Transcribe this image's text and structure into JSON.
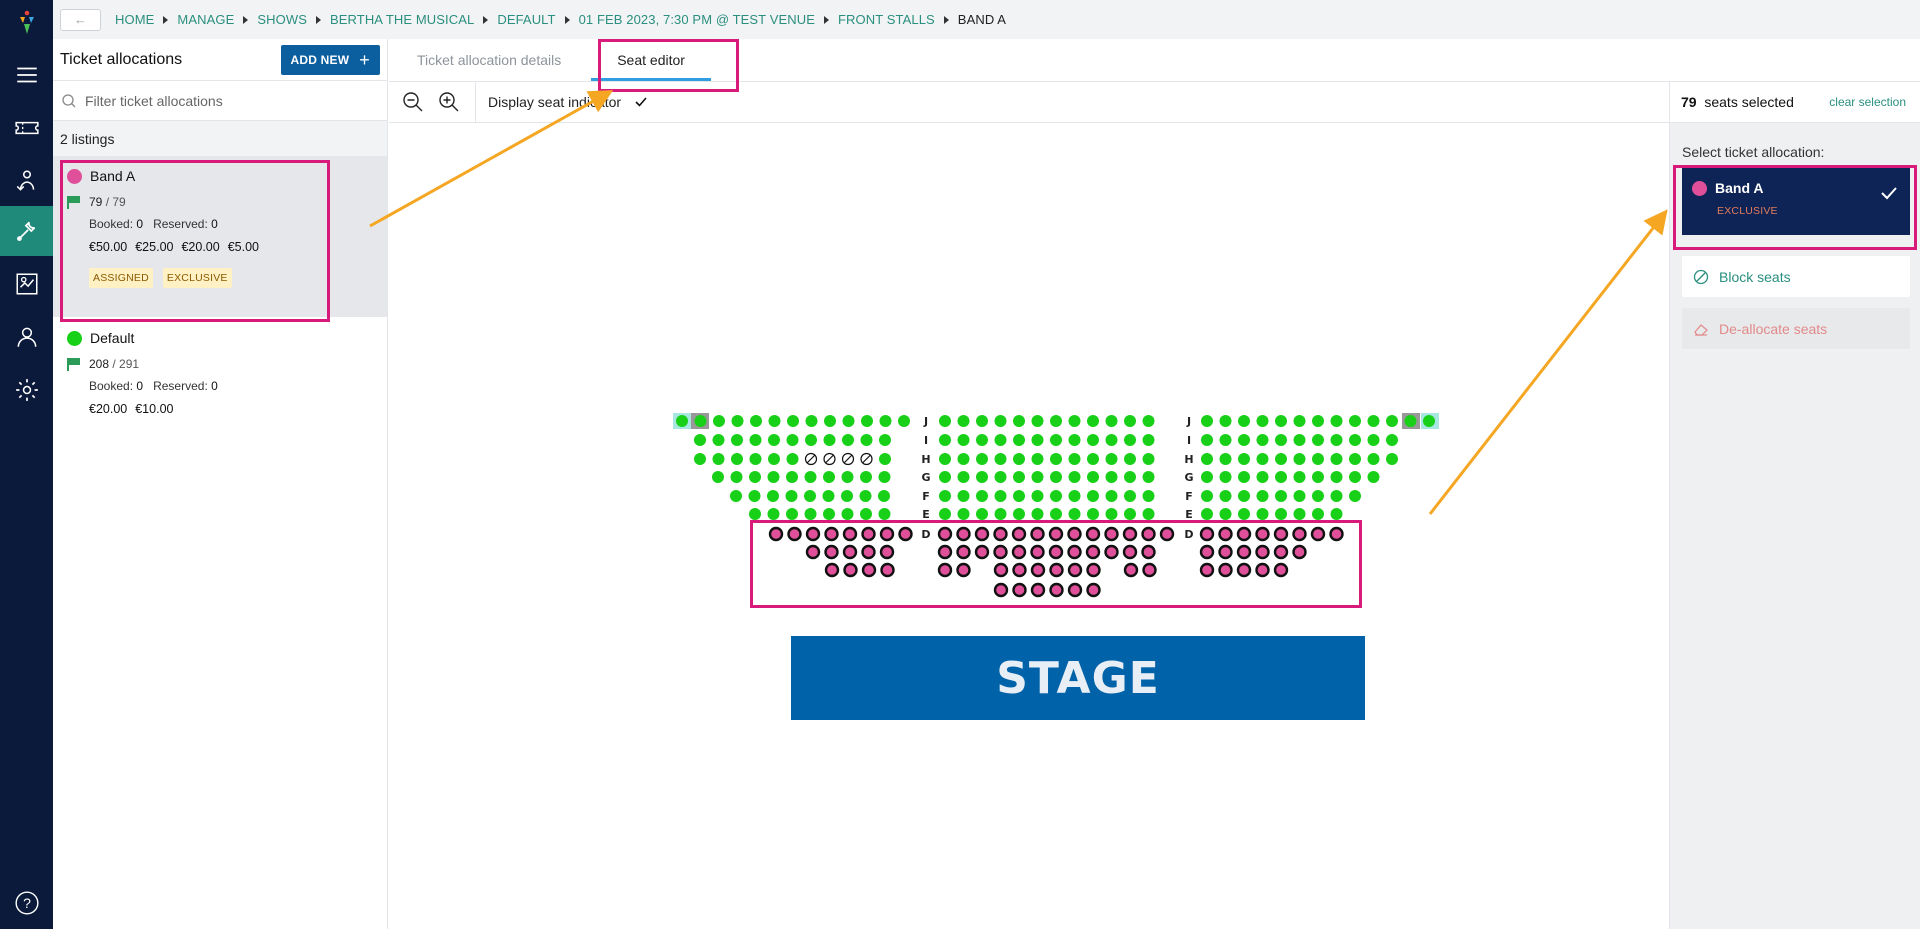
{
  "breadcrumb": {
    "back_label": "←",
    "items": [
      "HOME",
      "MANAGE",
      "SHOWS",
      "BERTHA THE MUSICAL",
      "DEFAULT",
      "01 FEB 2023, 7:30 PM @ TEST VENUE",
      "FRONT STALLS"
    ],
    "current": "BAND A"
  },
  "sidebar": {
    "title": "Ticket allocations",
    "add_new_label": "ADD NEW",
    "add_new_icon": "+",
    "filter_placeholder": "Filter ticket allocations",
    "listings_count": "2 listings",
    "listings": [
      {
        "name": "Band A",
        "color": "#e0509a",
        "count": "79",
        "total": " / 79",
        "booked_label": "Booked:",
        "booked_value": "0",
        "reserved_label": "Reserved:",
        "reserved_value": "0",
        "prices": [
          "€50.00",
          "€25.00",
          "€20.00",
          "€5.00"
        ],
        "badges": [
          "ASSIGNED",
          "EXCLUSIVE"
        ],
        "selected": true
      },
      {
        "name": "Default",
        "color": "#18d018",
        "count": "208",
        "total": " / 291",
        "booked_label": "Booked:",
        "booked_value": "0",
        "reserved_label": "Reserved:",
        "reserved_value": "0",
        "prices": [
          "€20.00",
          "€10.00"
        ],
        "badges": [],
        "selected": false
      }
    ]
  },
  "tabs": [
    {
      "label": "Ticket allocation details",
      "active": false
    },
    {
      "label": "Seat editor",
      "active": true
    }
  ],
  "toolbar": {
    "display_indicator_label": "Display seat indicator",
    "display_indicator_checked": true
  },
  "seatmap": {
    "stage_label": "STAGE",
    "row_labels_upper": [
      "J",
      "I",
      "H",
      "G",
      "F",
      "E"
    ],
    "row_label_lower": "D",
    "available_color": "#18d018",
    "band_a_color": "#e0509a"
  },
  "right_panel": {
    "seats_selected_count": "79",
    "seats_selected_label": "seats selected",
    "clear_selection_label": "clear selection",
    "select_label": "Select ticket allocation:",
    "selected_allocation": {
      "name": "Band A",
      "tag": "EXCLUSIVE",
      "color": "#e0509a"
    },
    "block_seats_label": "Block seats",
    "deallocate_label": "De-allocate seats"
  },
  "colors": {
    "nav_bg": "#0b1a3a",
    "nav_active": "#1f8a7a",
    "primary_blue": "#0b5f9e",
    "link_teal": "#2a8f7f",
    "highlight_border": "#d81b7a",
    "annotation_arrow": "#f5a623"
  }
}
